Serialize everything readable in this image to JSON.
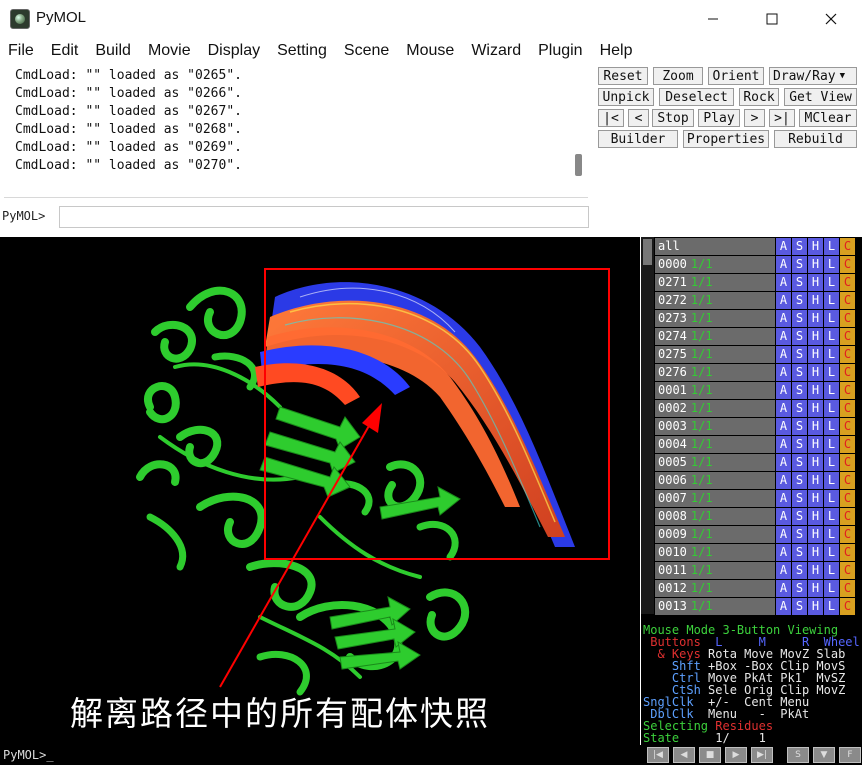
{
  "window": {
    "title": "PyMOL",
    "minimize_icon": "minimize-icon",
    "maximize_icon": "maximize-icon",
    "close_icon": "close-icon"
  },
  "menu": [
    "File",
    "Edit",
    "Build",
    "Movie",
    "Display",
    "Setting",
    "Scene",
    "Mouse",
    "Wizard",
    "Plugin",
    "Help"
  ],
  "log": [
    "CmdLoad: \"\" loaded as \"0265\".",
    "CmdLoad: \"\" loaded as \"0266\".",
    "CmdLoad: \"\" loaded as \"0267\".",
    "CmdLoad: \"\" loaded as \"0268\".",
    "CmdLoad: \"\" loaded as \"0269\".",
    "CmdLoad: \"\" loaded as \"0270\"."
  ],
  "command": {
    "prompt": "PyMOL>",
    "value": ""
  },
  "controls": {
    "reset": "Reset",
    "zoom": "Zoom",
    "orient": "Orient",
    "draw_ray": "Draw/Ray",
    "unpick": "Unpick",
    "deselect": "Deselect",
    "rock": "Rock",
    "get_view": "Get View",
    "first": "|<",
    "prev": "<",
    "stop": "Stop",
    "play": "Play",
    "next": ">",
    "last": ">|",
    "mclear": "MClear",
    "builder": "Builder",
    "properties": "Properties",
    "rebuild": "Rebuild"
  },
  "annotation": "解离路径中的所有配体快照",
  "objects": [
    {
      "name": "all",
      "state": ""
    },
    {
      "name": "0000",
      "state": "1/1"
    },
    {
      "name": "0271",
      "state": "1/1"
    },
    {
      "name": "0272",
      "state": "1/1"
    },
    {
      "name": "0273",
      "state": "1/1"
    },
    {
      "name": "0274",
      "state": "1/1"
    },
    {
      "name": "0275",
      "state": "1/1"
    },
    {
      "name": "0276",
      "state": "1/1"
    },
    {
      "name": "0001",
      "state": "1/1"
    },
    {
      "name": "0002",
      "state": "1/1"
    },
    {
      "name": "0003",
      "state": "1/1"
    },
    {
      "name": "0004",
      "state": "1/1"
    },
    {
      "name": "0005",
      "state": "1/1"
    },
    {
      "name": "0006",
      "state": "1/1"
    },
    {
      "name": "0007",
      "state": "1/1"
    },
    {
      "name": "0008",
      "state": "1/1"
    },
    {
      "name": "0009",
      "state": "1/1"
    },
    {
      "name": "0010",
      "state": "1/1"
    },
    {
      "name": "0011",
      "state": "1/1"
    },
    {
      "name": "0012",
      "state": "1/1"
    },
    {
      "name": "0013",
      "state": "1/1"
    }
  ],
  "object_buttons": [
    "A",
    "S",
    "H",
    "L",
    "C"
  ],
  "mouse_mode": {
    "l1_a": "Mouse Mode",
    "l1_b": " 3-Button Viewing",
    "l2_a": " Buttons",
    "l2_b": "  L     M     R  Wheel",
    "l3_a": "  & Keys",
    "l3_b": " Rota Move MovZ Slab",
    "l4_a": "    Shft",
    "l4_b": " +Box -Box Clip MovS",
    "l5_a": "    Ctrl",
    "l5_b": " Move PkAt Pk1  MvSZ",
    "l6_a": "    CtSh",
    "l6_b": " Sele Orig Clip MovZ",
    "l7_a": "SnglClk",
    "l7_b": "  +/-  Cent Menu",
    "l8_a": " DblClk",
    "l8_b": "  Menu   -  PkAt",
    "l9_a": "Selecting",
    "l9_b": " Residues",
    "l10_a": "State",
    "l10_b": "     1/    1"
  },
  "status": "PyMOL>_",
  "movie_buttons": [
    "|◀",
    "◀",
    "■",
    "▶",
    "▶|",
    "S",
    "▼",
    "F"
  ],
  "colors": {
    "protein": "#33dd33",
    "annotation_box": "#ff0000",
    "ligand_red": "#ff5a2a",
    "ligand_blue": "#2a3cff"
  }
}
